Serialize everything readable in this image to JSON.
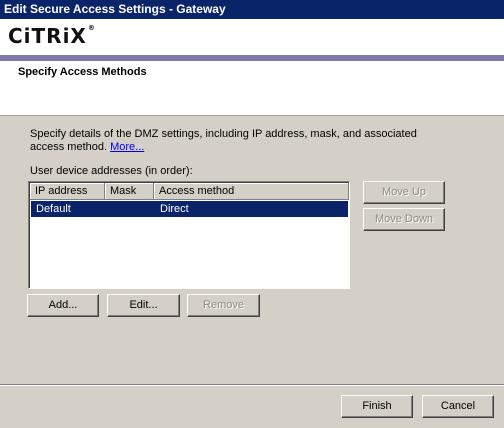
{
  "window": {
    "title": "Edit Secure Access Settings - Gateway"
  },
  "header": {
    "logo_text": "CiTRiX",
    "logo_mark": "®",
    "title": "Specify Access Methods"
  },
  "main": {
    "description": "Specify details of the DMZ settings, including IP address, mask, and associated access method.",
    "more_link": "More...",
    "list_label": "User device addresses (in order):",
    "columns": [
      "IP address",
      "Mask",
      "Access method"
    ],
    "rows": [
      {
        "ip": "Default",
        "mask": "",
        "method": "Direct",
        "selected": true
      }
    ],
    "buttons": {
      "move_up": "Move Up",
      "move_down": "Move Down",
      "add": "Add...",
      "edit": "Edit...",
      "remove": "Remove"
    }
  },
  "footer": {
    "finish": "Finish",
    "cancel": "Cancel"
  },
  "colors": {
    "titlebar": "#0a246a",
    "accent_bar": "#7d7aa9",
    "selection": "#0a246a",
    "dialog_bg": "#d4d0c8"
  }
}
